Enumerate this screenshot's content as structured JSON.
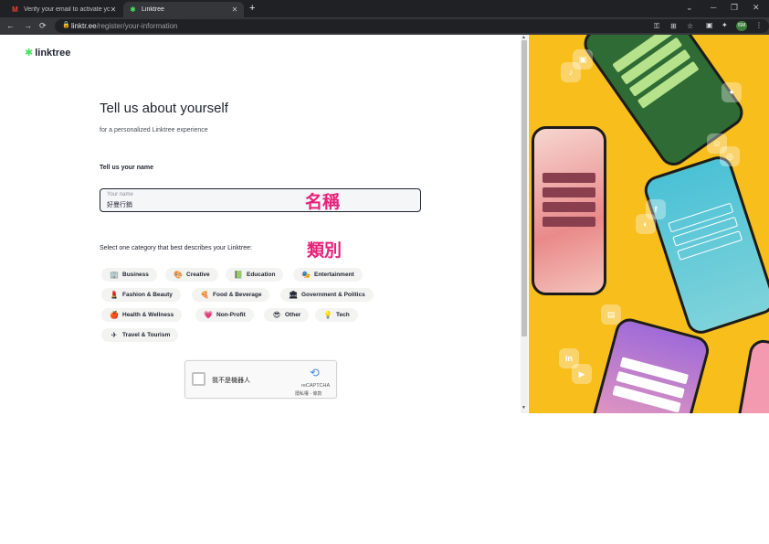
{
  "browser": {
    "tabs": [
      {
        "title": "Verify your email to activate yo",
        "icon": "gmail-icon",
        "active": false
      },
      {
        "title": "Linktree",
        "icon": "linktree-icon",
        "active": true
      }
    ],
    "new_tab": "+",
    "window_controls": {
      "minimize": "─",
      "maximize": "❐",
      "close": "✕",
      "tab_search": "⌄"
    },
    "url": {
      "host": "linktr.ee",
      "path": "/register/your-information"
    },
    "nav": {
      "back": "←",
      "forward": "→",
      "reload": "⟳"
    },
    "profile_label": "ISM"
  },
  "page": {
    "logo_text": "linktree",
    "heading": "Tell us about yourself",
    "subheading": "for a personalized Linktree experience",
    "name_section_label": "Tell us your name",
    "name_input": {
      "placeholder": "Your name",
      "value": "好曼行銷"
    },
    "annotation_name": "名稱",
    "category_label": "Select one category that best describes your Linktree:",
    "annotation_category": "類別",
    "categories": [
      {
        "label": "Business",
        "icon": "🏢"
      },
      {
        "label": "Creative",
        "icon": "🎨"
      },
      {
        "label": "Education",
        "icon": "📗"
      },
      {
        "label": "Entertainment",
        "icon": "🎭"
      },
      {
        "label": "Fashion & Beauty",
        "icon": "💄"
      },
      {
        "label": "Food & Beverage",
        "icon": "🍕"
      },
      {
        "label": "Government & Politics",
        "icon": "🏛"
      },
      {
        "label": "Health & Wellness",
        "icon": "🍎"
      },
      {
        "label": "Non-Profit",
        "icon": "💗"
      },
      {
        "label": "Other",
        "icon": "😎"
      },
      {
        "label": "Tech",
        "icon": "💡"
      },
      {
        "label": "Travel & Tourism",
        "icon": "✈"
      }
    ],
    "captcha": {
      "label": "我不是機器人",
      "brand": "reCAPTCHA",
      "terms": "隱私權 - 條款"
    }
  },
  "colors": {
    "accent": "#43e660",
    "annotation": "#e8217a",
    "promo_bg": "#f7be1c"
  }
}
